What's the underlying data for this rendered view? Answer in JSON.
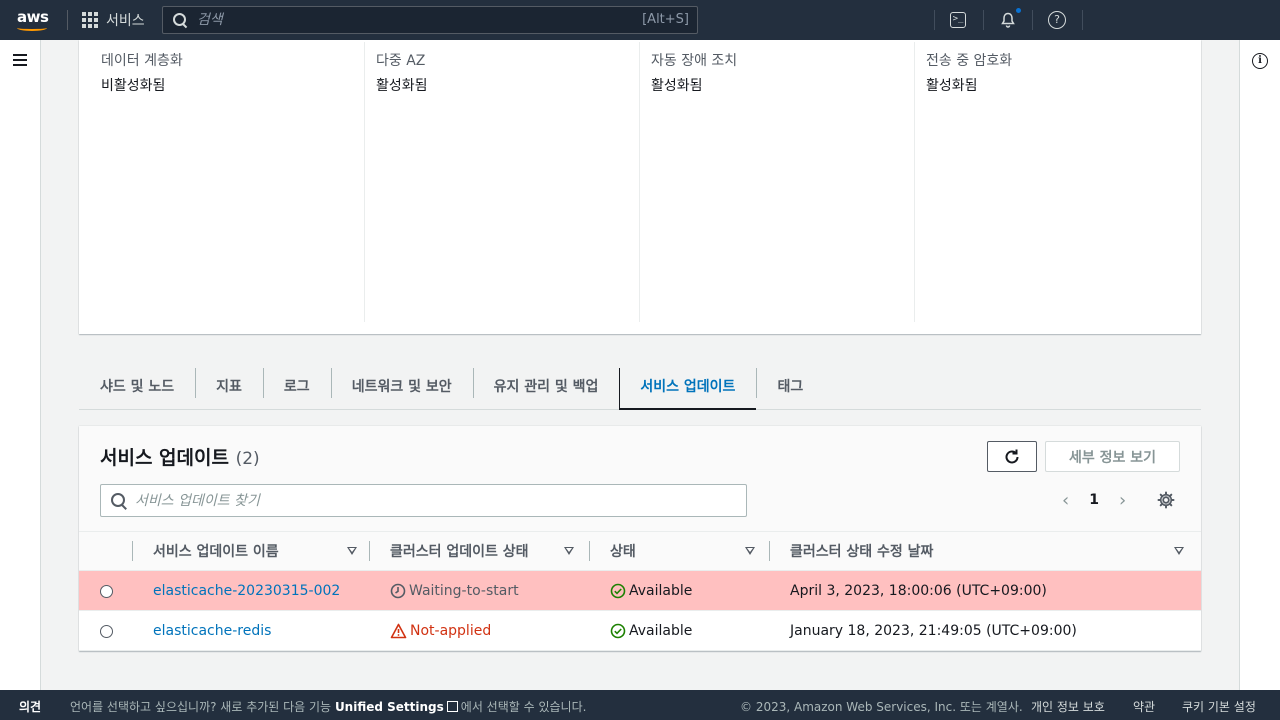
{
  "topnav": {
    "logo_text": "aws",
    "services_label": "서비스",
    "search_placeholder": "검색",
    "search_shortcut": "[Alt+S]"
  },
  "details": [
    {
      "label": "데이터 계층화",
      "value": "비활성화됨"
    },
    {
      "label": "다중 AZ",
      "value": "활성화됨"
    },
    {
      "label": "자동 장애 조치",
      "value": "활성화됨"
    },
    {
      "label": "전송 중 암호화",
      "value": "활성화됨"
    }
  ],
  "tabs": [
    {
      "label": "샤드 및 노드"
    },
    {
      "label": "지표"
    },
    {
      "label": "로그"
    },
    {
      "label": "네트워크 및 보안"
    },
    {
      "label": "유지 관리 및 백업"
    },
    {
      "label": "서비스 업데이트",
      "active": true
    },
    {
      "label": "태그"
    }
  ],
  "updates": {
    "title": "서비스 업데이트",
    "count": "(2)",
    "details_button": "세부 정보 보기",
    "filter_placeholder": "서비스 업데이트 찾기",
    "page": "1",
    "columns": [
      "서비스 업데이트 이름",
      "클러스터 업데이트 상태",
      "상태",
      "클러스터 상태 수정 날짜"
    ],
    "rows": [
      {
        "name": "elasticache-20230315-002",
        "cluster_status": "Waiting-to-start",
        "cluster_status_icon": "clock-icon",
        "status": "Available",
        "status_icon": "check-circle-icon",
        "date": "April 3, 2023, 18:00:06 (UTC+09:00)",
        "highlighted": true
      },
      {
        "name": "elasticache-redis",
        "cluster_status": "Not-applied",
        "cluster_status_icon": "warning-icon",
        "status": "Available",
        "status_icon": "check-circle-icon",
        "date": "January 18, 2023, 21:49:05 (UTC+09:00)",
        "highlighted": false
      }
    ]
  },
  "footer": {
    "feedback": "의견",
    "message_pre": "언어를 선택하고 싶으십니까? 새로 추가된 다음 기능",
    "message_link": "Unified Settings",
    "message_post": "에서 선택할 수 있습니다.",
    "copyright": "© 2023, Amazon Web Services, Inc. 또는 계열사.",
    "privacy": "개인 정보 보호",
    "terms": "약관",
    "cookies": "쿠키 기본 설정"
  },
  "colors": {
    "nav_bg": "#232f3e",
    "link": "#0073bb",
    "highlight_row": "#ffc0c0",
    "warning": "#d13212",
    "success": "#1d8102"
  }
}
